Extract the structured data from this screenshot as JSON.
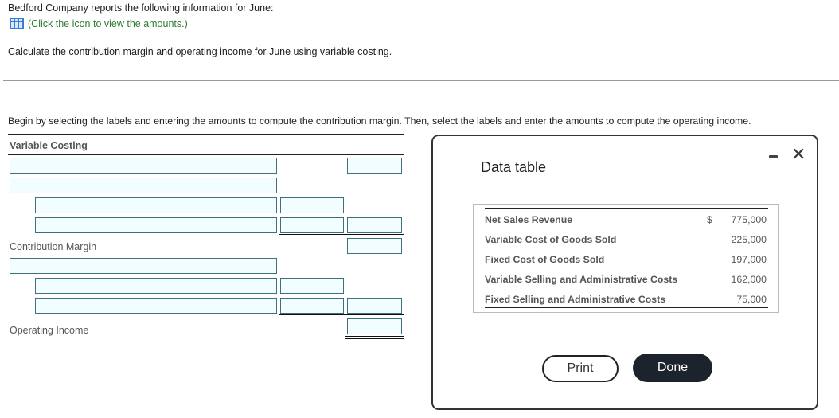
{
  "question": {
    "intro": "Bedford Company reports the following information for June:",
    "icon_link": "(Click the icon to view the amounts.)",
    "instruction": "Calculate the contribution margin and operating income for June using variable costing.",
    "step_instruction": "Begin by selecting the labels and entering the amounts to compute the contribution margin. Then, select the labels and enter the amounts to compute the operating income."
  },
  "worksheet": {
    "title": "Variable Costing",
    "contribution_margin_label": "Contribution Margin",
    "operating_income_label": "Operating Income",
    "inputs": {
      "r1_label": "",
      "r1_amount": "",
      "r2_label": "",
      "r3_label": "",
      "r3_amount": "",
      "r4_label": "",
      "r4_amount": "",
      "r4_total": "",
      "cm_total": "",
      "r5_label": "",
      "r6_label": "",
      "r6_amount": "",
      "r7_label": "",
      "r7_amount": "",
      "r7_total": "",
      "oi_total": ""
    }
  },
  "modal": {
    "title": "Data table",
    "rows": [
      {
        "name": "Net Sales Revenue",
        "currency": "$",
        "value": "775,000"
      },
      {
        "name": "Variable Cost of Goods Sold",
        "currency": "",
        "value": "225,000"
      },
      {
        "name": "Fixed Cost of Goods Sold",
        "currency": "",
        "value": "197,000"
      },
      {
        "name": "Variable Selling and Administrative Costs",
        "currency": "",
        "value": "162,000"
      },
      {
        "name": "Fixed Selling and Administrative Costs",
        "currency": "",
        "value": "75,000"
      }
    ],
    "print_label": "Print",
    "done_label": "Done",
    "close_symbol": "✕"
  }
}
